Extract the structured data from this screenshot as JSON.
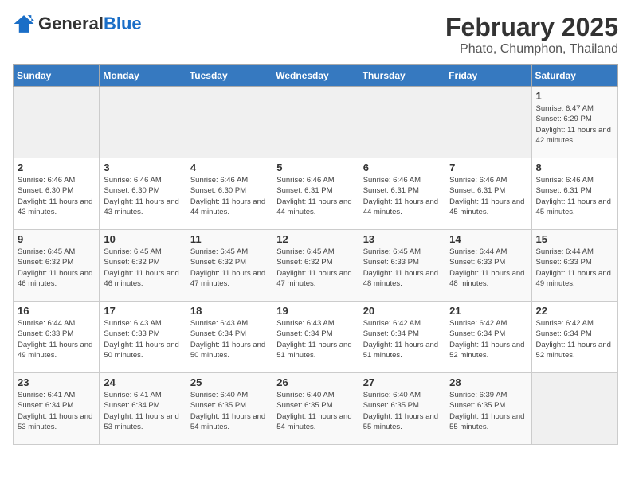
{
  "logo": {
    "general": "General",
    "blue": "Blue"
  },
  "title": {
    "month_year": "February 2025",
    "location": "Phato, Chumphon, Thailand"
  },
  "headers": [
    "Sunday",
    "Monday",
    "Tuesday",
    "Wednesday",
    "Thursday",
    "Friday",
    "Saturday"
  ],
  "weeks": [
    [
      {
        "day": "",
        "info": "",
        "empty": true
      },
      {
        "day": "",
        "info": "",
        "empty": true
      },
      {
        "day": "",
        "info": "",
        "empty": true
      },
      {
        "day": "",
        "info": "",
        "empty": true
      },
      {
        "day": "",
        "info": "",
        "empty": true
      },
      {
        "day": "",
        "info": "",
        "empty": true
      },
      {
        "day": "1",
        "info": "Sunrise: 6:47 AM\nSunset: 6:29 PM\nDaylight: 11 hours and 42 minutes."
      }
    ],
    [
      {
        "day": "2",
        "info": "Sunrise: 6:46 AM\nSunset: 6:30 PM\nDaylight: 11 hours and 43 minutes."
      },
      {
        "day": "3",
        "info": "Sunrise: 6:46 AM\nSunset: 6:30 PM\nDaylight: 11 hours and 43 minutes."
      },
      {
        "day": "4",
        "info": "Sunrise: 6:46 AM\nSunset: 6:30 PM\nDaylight: 11 hours and 44 minutes."
      },
      {
        "day": "5",
        "info": "Sunrise: 6:46 AM\nSunset: 6:31 PM\nDaylight: 11 hours and 44 minutes."
      },
      {
        "day": "6",
        "info": "Sunrise: 6:46 AM\nSunset: 6:31 PM\nDaylight: 11 hours and 44 minutes."
      },
      {
        "day": "7",
        "info": "Sunrise: 6:46 AM\nSunset: 6:31 PM\nDaylight: 11 hours and 45 minutes."
      },
      {
        "day": "8",
        "info": "Sunrise: 6:46 AM\nSunset: 6:31 PM\nDaylight: 11 hours and 45 minutes."
      }
    ],
    [
      {
        "day": "9",
        "info": "Sunrise: 6:45 AM\nSunset: 6:32 PM\nDaylight: 11 hours and 46 minutes."
      },
      {
        "day": "10",
        "info": "Sunrise: 6:45 AM\nSunset: 6:32 PM\nDaylight: 11 hours and 46 minutes."
      },
      {
        "day": "11",
        "info": "Sunrise: 6:45 AM\nSunset: 6:32 PM\nDaylight: 11 hours and 47 minutes."
      },
      {
        "day": "12",
        "info": "Sunrise: 6:45 AM\nSunset: 6:32 PM\nDaylight: 11 hours and 47 minutes."
      },
      {
        "day": "13",
        "info": "Sunrise: 6:45 AM\nSunset: 6:33 PM\nDaylight: 11 hours and 48 minutes."
      },
      {
        "day": "14",
        "info": "Sunrise: 6:44 AM\nSunset: 6:33 PM\nDaylight: 11 hours and 48 minutes."
      },
      {
        "day": "15",
        "info": "Sunrise: 6:44 AM\nSunset: 6:33 PM\nDaylight: 11 hours and 49 minutes."
      }
    ],
    [
      {
        "day": "16",
        "info": "Sunrise: 6:44 AM\nSunset: 6:33 PM\nDaylight: 11 hours and 49 minutes."
      },
      {
        "day": "17",
        "info": "Sunrise: 6:43 AM\nSunset: 6:33 PM\nDaylight: 11 hours and 50 minutes."
      },
      {
        "day": "18",
        "info": "Sunrise: 6:43 AM\nSunset: 6:34 PM\nDaylight: 11 hours and 50 minutes."
      },
      {
        "day": "19",
        "info": "Sunrise: 6:43 AM\nSunset: 6:34 PM\nDaylight: 11 hours and 51 minutes."
      },
      {
        "day": "20",
        "info": "Sunrise: 6:42 AM\nSunset: 6:34 PM\nDaylight: 11 hours and 51 minutes."
      },
      {
        "day": "21",
        "info": "Sunrise: 6:42 AM\nSunset: 6:34 PM\nDaylight: 11 hours and 52 minutes."
      },
      {
        "day": "22",
        "info": "Sunrise: 6:42 AM\nSunset: 6:34 PM\nDaylight: 11 hours and 52 minutes."
      }
    ],
    [
      {
        "day": "23",
        "info": "Sunrise: 6:41 AM\nSunset: 6:34 PM\nDaylight: 11 hours and 53 minutes."
      },
      {
        "day": "24",
        "info": "Sunrise: 6:41 AM\nSunset: 6:34 PM\nDaylight: 11 hours and 53 minutes."
      },
      {
        "day": "25",
        "info": "Sunrise: 6:40 AM\nSunset: 6:35 PM\nDaylight: 11 hours and 54 minutes."
      },
      {
        "day": "26",
        "info": "Sunrise: 6:40 AM\nSunset: 6:35 PM\nDaylight: 11 hours and 54 minutes."
      },
      {
        "day": "27",
        "info": "Sunrise: 6:40 AM\nSunset: 6:35 PM\nDaylight: 11 hours and 55 minutes."
      },
      {
        "day": "28",
        "info": "Sunrise: 6:39 AM\nSunset: 6:35 PM\nDaylight: 11 hours and 55 minutes."
      },
      {
        "day": "",
        "info": "",
        "empty": true
      }
    ]
  ]
}
